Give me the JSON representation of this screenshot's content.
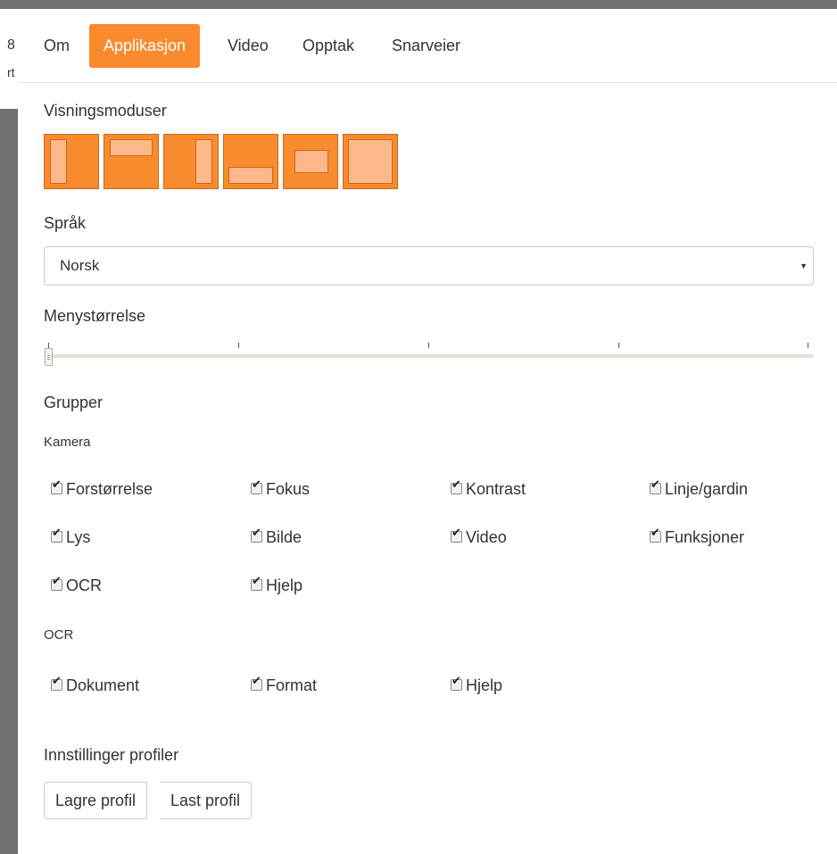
{
  "background": {
    "text_1": "8",
    "text_2": "rt"
  },
  "tabs": [
    {
      "label": "Om",
      "active": false
    },
    {
      "label": "Applikasjon",
      "active": true
    },
    {
      "label": "Video",
      "active": false
    },
    {
      "label": "Opptak",
      "active": false
    },
    {
      "label": "Snarveier",
      "active": false
    }
  ],
  "display_modes": {
    "title": "Visningsmoduser",
    "modes": [
      "split-left-icon",
      "split-top-icon",
      "split-right-icon",
      "split-bottom-icon",
      "picture-in-picture-icon",
      "fullscreen-icon"
    ],
    "color": "#f98b2e"
  },
  "language": {
    "title": "Språk",
    "selected": "Norsk"
  },
  "menu_size": {
    "title": "Menystørrelse",
    "value": 0,
    "steps": 5
  },
  "groups": {
    "title": "Grupper",
    "camera": {
      "title": "Kamera",
      "items": [
        {
          "label": "Forstørrelse",
          "checked": true
        },
        {
          "label": "Fokus",
          "checked": true
        },
        {
          "label": "Kontrast",
          "checked": true
        },
        {
          "label": "Linje/gardin",
          "checked": true
        },
        {
          "label": "Lys",
          "checked": true
        },
        {
          "label": "Bilde",
          "checked": true
        },
        {
          "label": "Video",
          "checked": true
        },
        {
          "label": "Funksjoner",
          "checked": true
        },
        {
          "label": "OCR",
          "checked": true
        },
        {
          "label": "Hjelp",
          "checked": true
        }
      ]
    },
    "ocr": {
      "title": "OCR",
      "items": [
        {
          "label": "Dokument",
          "checked": true
        },
        {
          "label": "Format",
          "checked": true
        },
        {
          "label": "Hjelp",
          "checked": true
        }
      ]
    }
  },
  "profiles": {
    "title": "Innstillinger profiler",
    "save_label": "Lagre profil",
    "load_label": "Last profil"
  },
  "colors": {
    "accent": "#f98b2e",
    "accent_light": "#fdb88a"
  }
}
